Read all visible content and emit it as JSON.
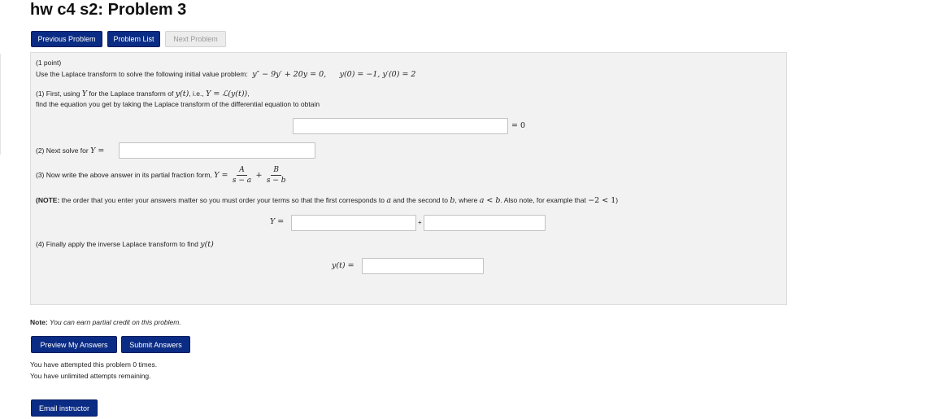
{
  "page": {
    "title": "hw c4 s2: Problem 3"
  },
  "nav": {
    "previous": "Previous Problem",
    "list": "Problem List",
    "next": "Next Problem"
  },
  "problem": {
    "points": "(1 point)",
    "intro": "Use the Laplace transform to solve the following initial value problem:",
    "ode": "y″ − 9y′ + 20y = 0,",
    "initial": "y(0) = −1, y′(0) = 2",
    "step1_a": "(1) First, using",
    "step1_Y": "Y",
    "step1_b": "for the Laplace transform of",
    "step1_yt": "y(t)",
    "step1_c": ", i.e.,",
    "step1_def": "Y = ℒ(y(t))",
    "step1_dot": ",",
    "step1_line2": "find the equation you get by taking the Laplace transform of the differential equation to obtain",
    "eq_zero": "= 0",
    "step2": "(2) Next solve for",
    "step2_Y": "Y =",
    "step3": "(3) Now write the above answer in its partial fraction form,",
    "step3_Y": "Y =",
    "frac_a_num": "A",
    "frac_a_den": "s − a",
    "frac_b_num": "B",
    "frac_b_den": "s − b",
    "plus": "+",
    "note_label": "(NOTE:",
    "note_text": "the order that you enter your answers matter so you must order your terms so that the first corresponds to",
    "note_a": "a",
    "note_mid": "and the second to",
    "note_b": "b",
    "note_where": ", where",
    "note_ineq": "a < b",
    "note_also": ". Also note, for example that",
    "note_ex": "−2 < 1",
    "note_close": ")",
    "y_eq": "Y =",
    "plus_small": "+",
    "step4": "(4) Finally apply the inverse Laplace transform to find",
    "step4_yt": "y(t)",
    "yt_eq": "y(t) =",
    "inputs": {
      "transform_eq": "",
      "solve_Y": "",
      "pf_first": "",
      "pf_second": "",
      "yt_answer": ""
    }
  },
  "footer": {
    "note_label": "Note:",
    "note_text": "You can earn partial credit on this problem.",
    "preview": "Preview My Answers",
    "submit": "Submit Answers",
    "attempts": "You have attempted this problem 0 times.",
    "remaining": "You have unlimited attempts remaining.",
    "email": "Email instructor"
  },
  "colors": {
    "primary_button": "#0b2c84",
    "disabled_button": "#ececec",
    "panel": "#f2f2f2"
  }
}
